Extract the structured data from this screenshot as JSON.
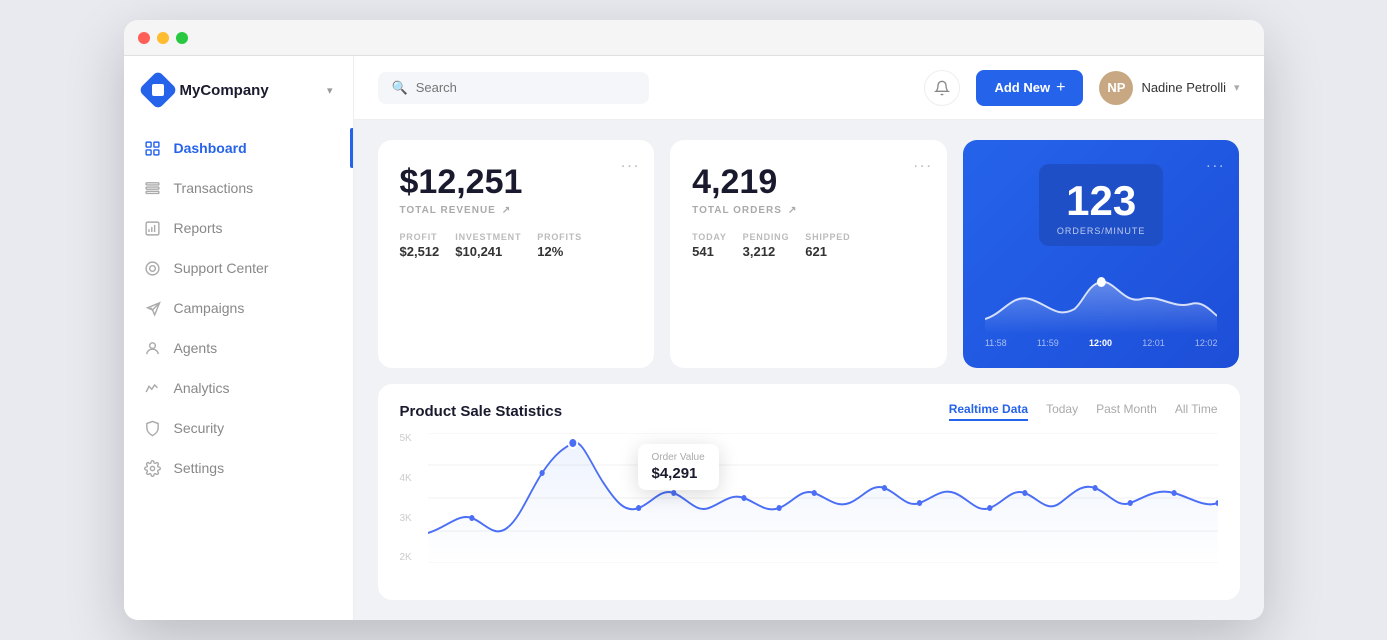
{
  "brand": {
    "name": "MyCompany",
    "chevron": "▾"
  },
  "nav": {
    "items": [
      {
        "id": "dashboard",
        "label": "Dashboard",
        "active": true,
        "icon": "dashboard"
      },
      {
        "id": "transactions",
        "label": "Transactions",
        "active": false,
        "icon": "transactions"
      },
      {
        "id": "reports",
        "label": "Reports",
        "active": false,
        "icon": "reports"
      },
      {
        "id": "support",
        "label": "Support Center",
        "active": false,
        "icon": "support"
      },
      {
        "id": "campaigns",
        "label": "Campaigns",
        "active": false,
        "icon": "campaigns"
      },
      {
        "id": "agents",
        "label": "Agents",
        "active": false,
        "icon": "agents"
      },
      {
        "id": "analytics",
        "label": "Analytics",
        "active": false,
        "icon": "analytics"
      },
      {
        "id": "security",
        "label": "Security",
        "active": false,
        "icon": "security"
      },
      {
        "id": "settings",
        "label": "Settings",
        "active": false,
        "icon": "settings"
      }
    ]
  },
  "header": {
    "search_placeholder": "Search",
    "add_new_label": "Add New",
    "user_name": "Nadine Petrolli",
    "chevron": "▾"
  },
  "cards": {
    "revenue": {
      "value": "$12,251",
      "label": "TOTAL REVENUE",
      "menu": "...",
      "sub": [
        {
          "label": "PROFIT",
          "value": "$2,512"
        },
        {
          "label": "INVESTMENT",
          "value": "$10,241"
        },
        {
          "label": "PROFITS",
          "value": "12%"
        }
      ]
    },
    "orders": {
      "value": "4,219",
      "label": "TOTAL ORDERS",
      "menu": "...",
      "sub": [
        {
          "label": "TODAY",
          "value": "541"
        },
        {
          "label": "PENDING",
          "value": "3,212"
        },
        {
          "label": "SHIPPED",
          "value": "621"
        }
      ]
    },
    "realtime": {
      "orders_per_min": "123",
      "orders_label": "ORDERS/MINUTE",
      "menu": "...",
      "time_labels": [
        "11:58",
        "11:59",
        "12:00",
        "12:01",
        "12:02"
      ],
      "active_time": "12:00"
    }
  },
  "chart": {
    "title": "Product Sale Statistics",
    "tabs": [
      {
        "label": "Realtime Data",
        "active": true
      },
      {
        "label": "Today",
        "active": false
      },
      {
        "label": "Past Month",
        "active": false
      },
      {
        "label": "All Time",
        "active": false
      }
    ],
    "tooltip": {
      "label": "Order Value",
      "value": "$4,291"
    },
    "y_labels": [
      "5K",
      "4K",
      "3K",
      "2K"
    ]
  }
}
